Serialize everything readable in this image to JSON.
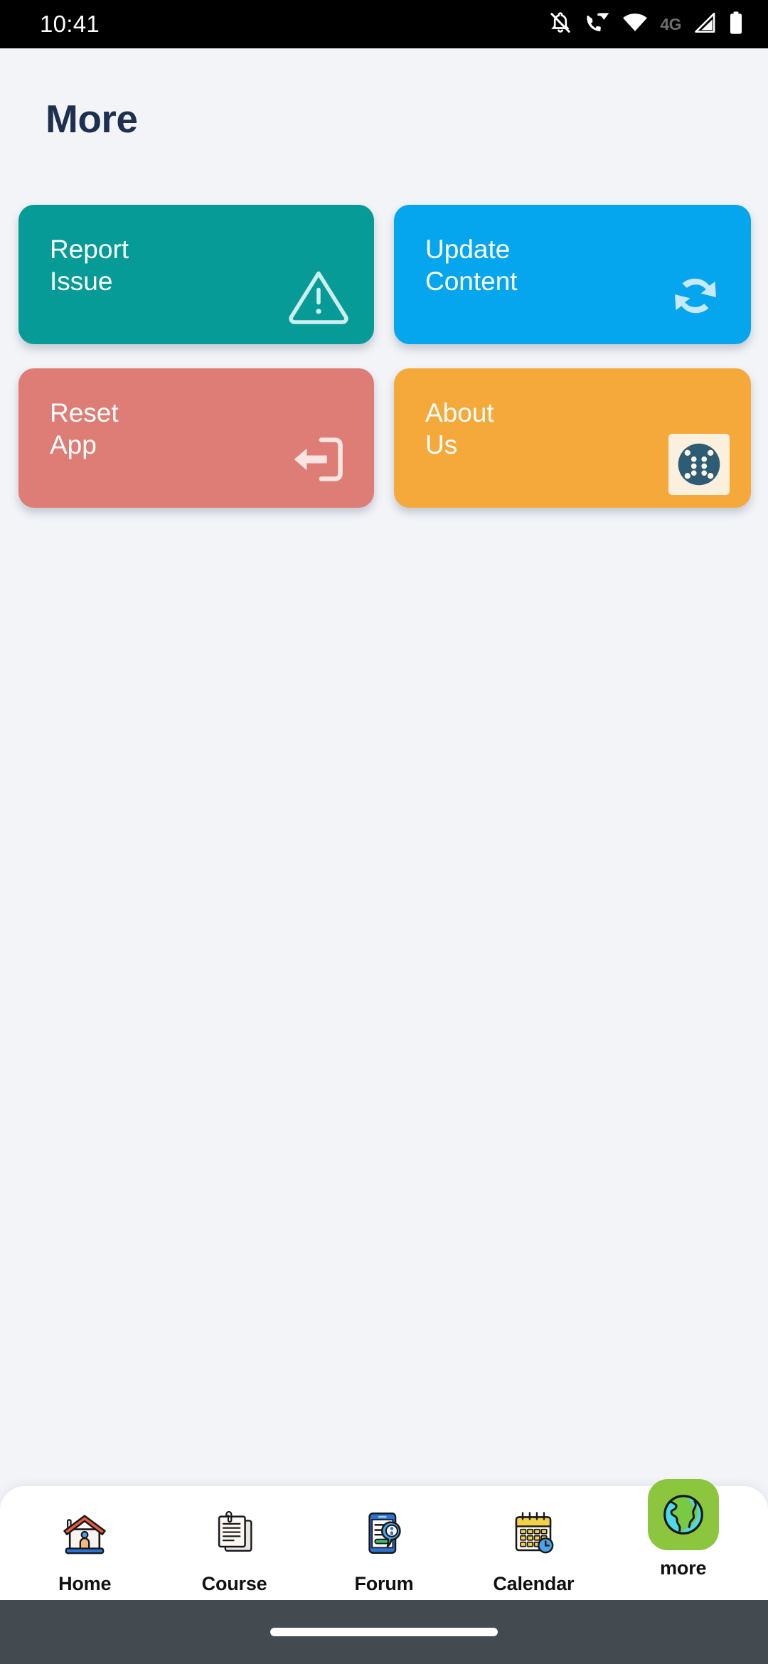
{
  "status_bar": {
    "time": "10:41",
    "network_label": "4G",
    "icons": [
      "notifications-off-icon",
      "wifi-calling-icon",
      "wifi-icon",
      "cellular-signal-icon",
      "battery-icon"
    ]
  },
  "header": {
    "title": "More"
  },
  "cards": [
    {
      "label": "Report\nIssue",
      "icon": "warning-triangle-icon",
      "bg_color": "#069b96",
      "text_color": "#ffffff",
      "icon_color": "#cdeeee"
    },
    {
      "label": "Update\nContent",
      "icon": "refresh-sync-icon",
      "bg_color": "#06a6ef",
      "text_color": "#ffffff",
      "icon_color": "#c8e9fb"
    },
    {
      "label": "Reset\nApp",
      "icon": "logout-icon",
      "bg_color": "#dd7d75",
      "text_color": "#ffffff",
      "icon_color": "#fbe5e2"
    },
    {
      "label": "About\nUs",
      "icon": "about-us-logo-icon",
      "bg_color": "#f5a93a",
      "text_color": "#ffffff",
      "icon_color": "#2d5d74"
    }
  ],
  "bottom_nav": {
    "active_index": 4,
    "active_highlight_color": "#8cc63f",
    "items": [
      {
        "label": "Home",
        "icon": "house-icon"
      },
      {
        "label": "Course",
        "icon": "documents-icon"
      },
      {
        "label": "Forum",
        "icon": "phone-chat-icon"
      },
      {
        "label": "Calendar",
        "icon": "calendar-clock-icon"
      },
      {
        "label": "more",
        "icon": "globe-icon"
      }
    ]
  },
  "gesture_bar": {
    "handle": "home-indicator"
  }
}
